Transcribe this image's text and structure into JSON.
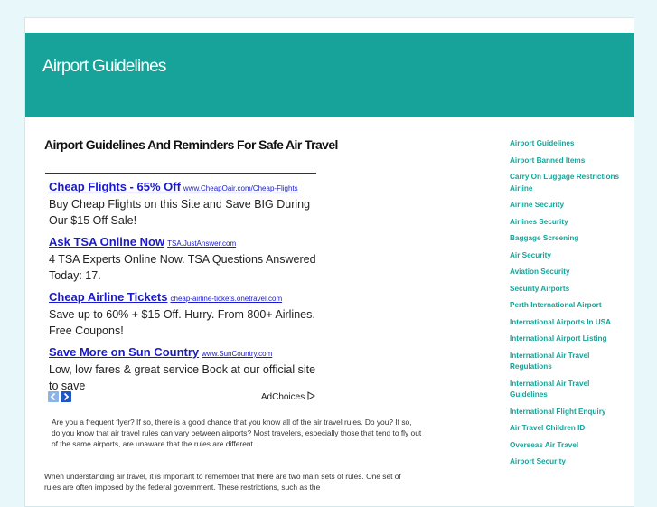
{
  "header": {
    "site_title": "Airport Guidelines"
  },
  "main": {
    "article_title": "Airport Guidelines And Reminders For Safe Air Travel"
  },
  "ads": [
    {
      "title": "Cheap Flights - 65% Off",
      "url": "www.CheapOair.com/Cheap-Flights",
      "desc": "Buy Cheap Flights on this Site and Save BIG During Our $15 Off Sale!"
    },
    {
      "title": "Ask TSA Online Now",
      "url": "TSA.JustAnswer.com",
      "desc": "4 TSA Experts Online Now. TSA Questions Answered Today: 17."
    },
    {
      "title": "Cheap Airline Tickets",
      "url": "cheap-airline-tickets.onetravel.com",
      "desc": "Save up to 60% + $15 Off. Hurry. From 800+ Airlines. Free Coupons!"
    },
    {
      "title": "Save More on Sun Country",
      "url": "www.SunCountry.com",
      "desc": "Low, low fares & great service Book at our official site to save"
    }
  ],
  "adchoices": {
    "label": "AdChoices",
    "icon": "adchoices-icon"
  },
  "nav": {
    "prev_icon": "chevron-left-icon",
    "next_icon": "chevron-right-icon"
  },
  "body_text": {
    "para1": "Are you a frequent flyer? If so, there is a good chance that you know all of the air travel rules. Do you? If so, do you know that air travel rules can vary between airports? Most travelers, especially those that tend to fly out of the same airports, are unaware that the rules are different.",
    "para2": "When understanding air travel, it is important to remember that there are two main sets of rules. One set of rules are often imposed by the federal government. These restrictions, such as the"
  },
  "sidebar": {
    "links": [
      "Airport Guidelines",
      "Airport Banned Items",
      "Carry On Luggage Restrictions Airline",
      "Airline Security",
      "Airlines Security",
      "Baggage Screening",
      "Air Security",
      "Aviation Security",
      "Security Airports",
      "Perth International Airport",
      "International Airports In USA",
      "International Airport Listing",
      "International Air Travel Regulations",
      "International Air Travel Guidelines",
      "International Flight Enquiry",
      "Air Travel Children ID",
      "Overseas Air Travel",
      "Airport Security"
    ]
  },
  "colors": {
    "accent": "#17a399",
    "background": "#e8f8fa",
    "link": "#1a1acc"
  }
}
